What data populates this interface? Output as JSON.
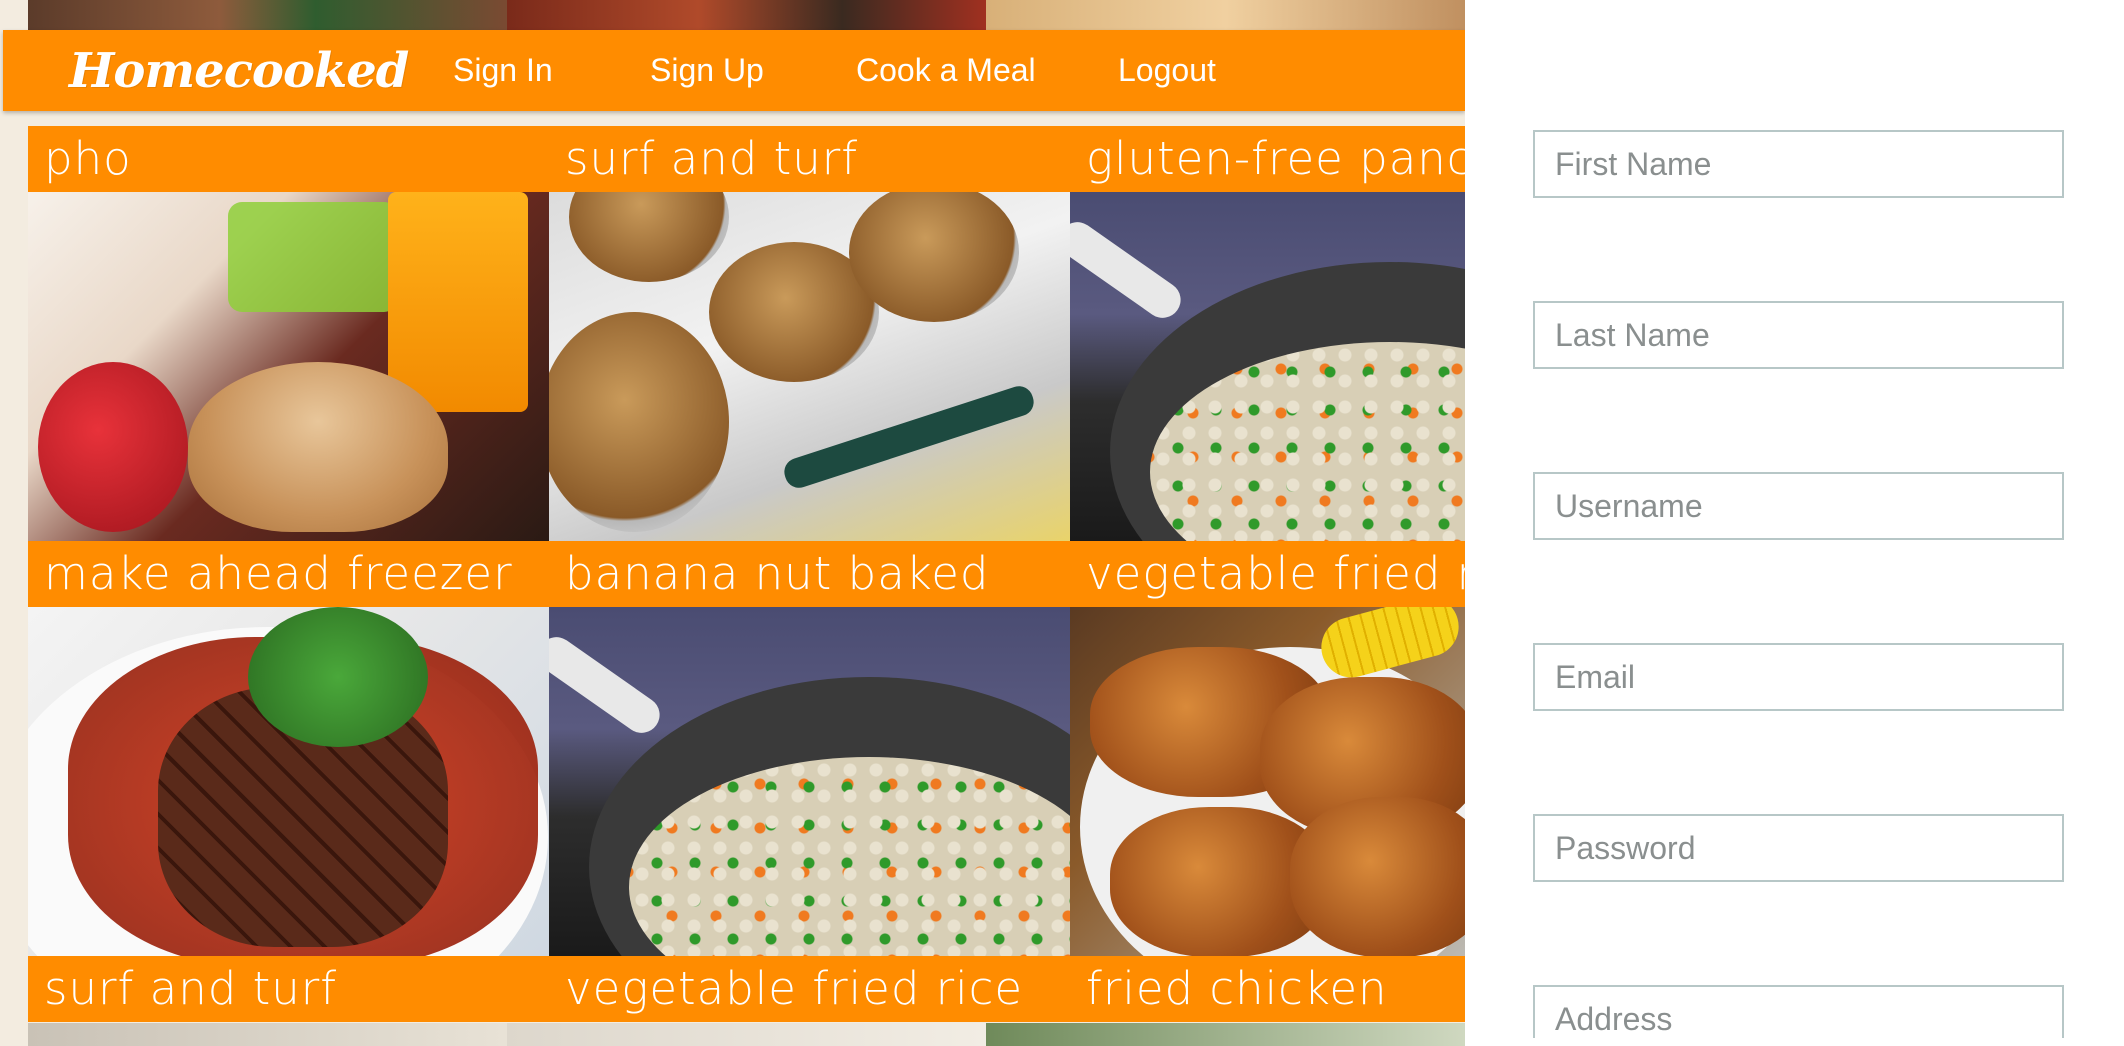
{
  "nav": {
    "brand": "Homecooked",
    "links": [
      "Sign In",
      "Sign Up",
      "Cook a Meal",
      "Logout"
    ]
  },
  "gallery": {
    "labels": [
      "pho",
      "surf and turf",
      "gluten-free panca",
      "make ahead freezer",
      "banana nut baked",
      "vegetable fried ric",
      "surf and turf",
      "vegetable fried rice",
      "fried chicken"
    ],
    "photos": [
      "breakfast-sandwich-strawberries-photo",
      "banana-nut-granola-cups-photo",
      "vegetable-fried-rice-pan-photo",
      "steak-and-lobster-photo",
      "vegetable-fried-rice-pan-photo",
      "fried-chicken-corn-photo"
    ]
  },
  "form": {
    "fields": [
      {
        "name": "first-name-field",
        "placeholder": "First Name"
      },
      {
        "name": "last-name-field",
        "placeholder": "Last Name"
      },
      {
        "name": "username-field",
        "placeholder": "Username"
      },
      {
        "name": "email-field",
        "placeholder": "Email"
      },
      {
        "name": "password-field",
        "placeholder": "Password"
      },
      {
        "name": "address-field",
        "placeholder": "Address"
      }
    ]
  },
  "colors": {
    "accent": "#ff8c00",
    "field_border": "#b7c7c7",
    "panel_bg": "#ffffff"
  }
}
